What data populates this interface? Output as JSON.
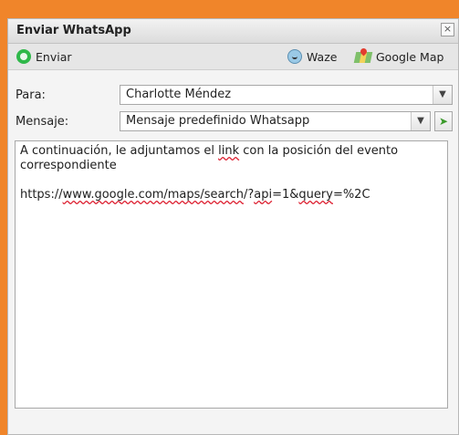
{
  "dialog": {
    "title": "Enviar WhatsApp",
    "close_glyph": "×"
  },
  "toolbar": {
    "send_label": "Enviar",
    "send_icon": "whatsapp-icon",
    "waze_label": "Waze",
    "waze_icon": "waze-icon",
    "gmap_label": "Google Map",
    "gmap_icon": "google-map-icon"
  },
  "form": {
    "to_label": "Para:",
    "to_value": "Charlotte Méndez",
    "message_label": "Mensaje:",
    "template_value": "Mensaje predefinido Whatsapp",
    "insert_icon": "insert-template-icon"
  },
  "message": {
    "line1_a": "A continuación, le adjuntamos el ",
    "line1_link": "link",
    "line1_b": " con la posición del evento correspondiente",
    "url_a": "https://",
    "url_b": "www.google.com/maps/search",
    "url_c": "/?",
    "url_d": "api",
    "url_e": "=1&",
    "url_f": "query",
    "url_g": "=%2C"
  },
  "colors": {
    "background": "#f0852a",
    "whatsapp": "#2fb84a"
  }
}
